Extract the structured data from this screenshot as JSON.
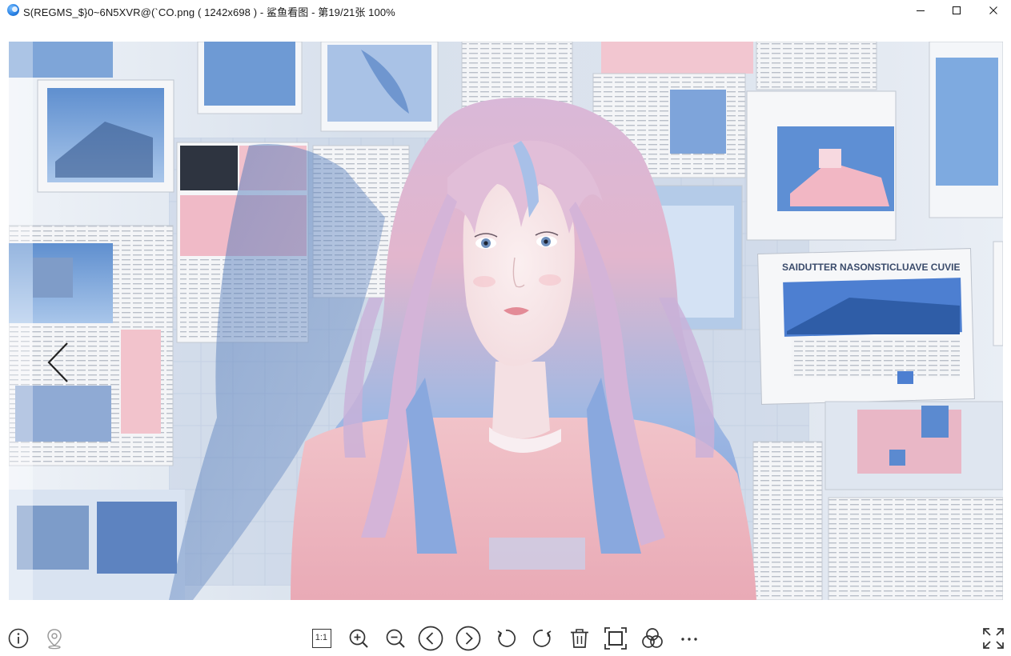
{
  "window": {
    "title": "S(REGMS_$}0~6N5XVR@(`CO.png ( 1242x698 ) - 鲨鱼看图 - 第19/21张 100%",
    "minimize_label": "Minimize",
    "maximize_label": "Maximize",
    "close_label": "Close"
  },
  "image": {
    "headline": "SAIDUTTER NASONSTICLUAVE CUVIE"
  },
  "toolbar": {
    "info_icon": "info-icon",
    "location_icon": "location-pin-icon",
    "actual_size_label": "1:1",
    "zoom_in_icon": "zoom-in-icon",
    "zoom_out_icon": "zoom-out-icon",
    "previous_icon": "previous-image-icon",
    "next_icon": "next-image-icon",
    "rotate_left_icon": "rotate-left-icon",
    "rotate_right_icon": "rotate-right-icon",
    "delete_icon": "trash-icon",
    "crop_icon": "crop-frame-icon",
    "filters_icon": "filters-icon",
    "more_icon": "more-icon",
    "fullscreen_icon": "fullscreen-icon"
  },
  "colors": {
    "icon": "#333333",
    "title_text": "#1a1a1a",
    "canvas_bg": "#dfe6ef"
  }
}
